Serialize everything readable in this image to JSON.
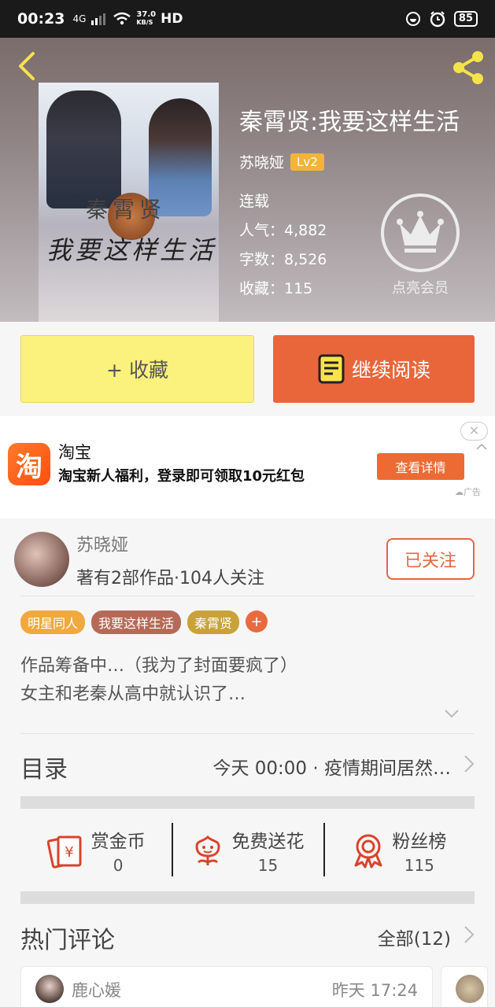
{
  "status_bar": {
    "time": "00:23",
    "network": "4G",
    "speed_value": "37.0",
    "speed_unit": "KB/S",
    "hd": "HD",
    "battery": "85"
  },
  "book": {
    "title": "秦霄贤:我要这样生活",
    "author": "苏晓娅",
    "level": "Lv2",
    "status": "连载",
    "popularity": "人气：4,882",
    "words": "字数：8,526",
    "favorites": "收藏：115",
    "cover_text_1": "秦霄贤",
    "cover_text_2": "我要这样生活",
    "member_label": "点亮会员"
  },
  "actions": {
    "favorite_label": "+ 收藏",
    "read_label": "继续阅读"
  },
  "ad": {
    "logo_char": "淘",
    "title": "淘宝",
    "description": "淘宝新人福利，登录即可领取10元红包",
    "cta": "查看详情",
    "close": "✕",
    "label": "广告"
  },
  "author_card": {
    "name": "苏晓娅",
    "stats": "著有2部作品·104人关注",
    "follow_label": "已关注",
    "tags": [
      "明星同人",
      "我要这样生活",
      "秦霄贤"
    ],
    "tag_add": "+",
    "intro_line1": "作品筹备中…（我为了封面要疯了）",
    "intro_line2": "女主和老秦从高中就认识了…"
  },
  "catalog": {
    "label": "目录",
    "latest": "今天 00:00 · 疫情期间居然…"
  },
  "rewards": [
    {
      "label": "赏金币",
      "value": "0",
      "icon": "coin-envelope-icon"
    },
    {
      "label": "免费送花",
      "value": "15",
      "icon": "flower-icon"
    },
    {
      "label": "粉丝榜",
      "value": "115",
      "icon": "medal-icon"
    }
  ],
  "comments": {
    "label": "热门评论",
    "all": "全部(12)",
    "first_user": "鹿心媛",
    "first_time": "昨天 17:24"
  },
  "colors": {
    "accent": "#e9663b",
    "favorite_bg": "#fbf17d",
    "level_badge": "#f2b53a",
    "icon_red": "#d9442c"
  }
}
